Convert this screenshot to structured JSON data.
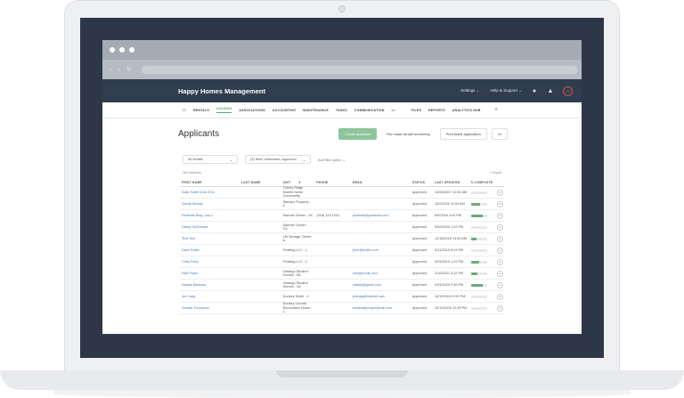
{
  "app": {
    "title": "Happy Homes Management"
  },
  "header": {
    "settings": "Settings",
    "help": "Help & Support",
    "avatar_initials": "JS",
    "icons": [
      "chat-icon",
      "bell-icon"
    ]
  },
  "tabs": [
    "RENTALS",
    "LEASING",
    "ASSOCIATIONS",
    "ACCOUNTING",
    "MAINTENANCE",
    "TASKS",
    "COMMUNICATION",
    "•••",
    "FILES",
    "REPORTS",
    "ANALYTICS HUB"
  ],
  "active_tab": "LEASING",
  "page": {
    "title": "Applicants",
    "create_label": "Create applicant",
    "screening_label": "Run basic tenant screening",
    "print_label": "Print blank application",
    "more_label": "•••"
  },
  "filters": {
    "f1": "All rentals",
    "f2": "(3) New, Undecided, Approved",
    "add": "Add filter option"
  },
  "meta": {
    "count": "183 matches",
    "export": "Export"
  },
  "columns": [
    "FIRST NAME",
    "LAST NAME",
    "UNIT",
    "PHONE",
    "EMAIL",
    "STATUS",
    "LAST UPDATED",
    "% COMPLETE"
  ],
  "rows": [
    {
      "first": "Sally Smith (Unit 203)",
      "last": "",
      "unit": "Turney Ridge Mobile Home Community",
      "phone": "",
      "email": "",
      "status": "Approved",
      "updated": "10/26/2017 10:51 AM",
      "complete": 0
    },
    {
      "first": "Sandy Woody",
      "last": "",
      "unit": "Sandy's Property - 4",
      "phone": "",
      "email": "",
      "status": "Approved",
      "updated": "12/2/2020 11:04 AM",
      "complete": 60
    },
    {
      "first": "Pedestal Bldg. July 1",
      "last": "",
      "unit": "Samuel Center - 04",
      "phone": "(216) 123 1241",
      "email": "pedestal@pedestal.com",
      "status": "Approved",
      "updated": "6/9/2018 2:42 PM",
      "complete": 75
    },
    {
      "first": "Danny McDonald",
      "last": "",
      "unit": "Samuel Center - G2",
      "phone": "",
      "email": "",
      "status": "Approved",
      "updated": "5/26/2020 1:22 PM",
      "complete": 0
    },
    {
      "first": "Test Test",
      "last": "",
      "unit": "LM Storage Center A",
      "phone": "",
      "email": "",
      "status": "Approved",
      "updated": "11/16/2018 10:45 AM",
      "complete": 35
    },
    {
      "first": "Dave Smith",
      "last": "",
      "unit": "Frosting LLC - 1",
      "phone": "",
      "email": "jlove@smith.com",
      "status": "Approved",
      "updated": "5/14/2019 5:01 PM",
      "complete": 0
    },
    {
      "first": "Chris Perry",
      "last": "",
      "unit": "Frosting LLC - 1",
      "phone": "",
      "email": "",
      "status": "Approved",
      "updated": "3/29/2019 1:22 PM",
      "complete": 55
    },
    {
      "first": "Nick Pouls",
      "last": "",
      "unit": "Oswego Student Homes - 5A",
      "phone": "",
      "email": "nick@pouls.com",
      "status": "Approved",
      "updated": "2/16/2021 3:12 PM",
      "complete": 40
    },
    {
      "first": "Natalia Barbosa",
      "last": "",
      "unit": "Oswego Student Homes - 2A",
      "phone": "",
      "email": "natalia@gmail.com",
      "status": "Approved",
      "updated": "2/24/2020 2:40 PM",
      "complete": 75
    },
    {
      "first": "Jet Craig",
      "last": "",
      "unit": "Dunkey Smith - 1",
      "phone": "",
      "email": "jetcraig@hotmail.com",
      "status": "Approved",
      "updated": "12/10/2019 2:52 PM",
      "complete": 0
    },
    {
      "first": "Sandra Thompson",
      "last": "",
      "unit": "Dunkey Current Renovation Home - 1",
      "phone": "",
      "email": "sandra@propertymail.com",
      "status": "Approved",
      "updated": "12/10/2019 12:25 PM",
      "complete": 0
    }
  ],
  "colors": {
    "header_bg": "#2f3d4f",
    "accent": "#5aa469",
    "bezel": "#2d3748"
  }
}
